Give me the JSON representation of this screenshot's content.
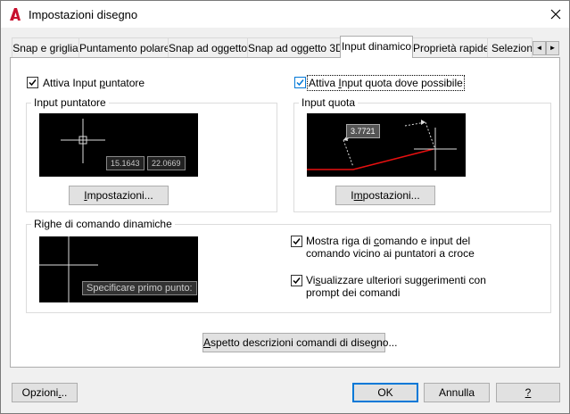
{
  "window": {
    "title": "Impostazioni disegno"
  },
  "tabs": [
    {
      "label": "Snap e griglia"
    },
    {
      "label": "Puntamento polare"
    },
    {
      "label": "Snap ad oggetto"
    },
    {
      "label": "Snap ad oggetto 3D"
    },
    {
      "label": "Input dinamico"
    },
    {
      "label": "Proprietà rapide"
    },
    {
      "label": "Selezione"
    }
  ],
  "tab_scroll": {
    "left": "◄",
    "right": "►"
  },
  "checkboxes": {
    "pointer_input": {
      "label_pre": "Attiva Input ",
      "label_u": "p",
      "label_post": "untatore",
      "checked": true
    },
    "dimension_input": {
      "label_pre": "Attiva ",
      "label_u": "I",
      "label_post": "nput quota dove possibile",
      "checked": true
    },
    "command_prompt": {
      "line1_pre": "Mostra riga di ",
      "line1_u": "c",
      "line1_post": "omando e input del",
      "line2": "comando vicino ai puntatori a croce",
      "checked": true
    },
    "extra_prompts": {
      "line1_pre": "Vi",
      "line1_u": "s",
      "line1_post": "ualizzare ulteriori suggerimenti con",
      "line2": "prompt dei comandi",
      "checked": true
    }
  },
  "groups": {
    "pointer_input": {
      "title": "Input puntatore",
      "preview_values": [
        "15.1643",
        "22.0669"
      ],
      "settings_button": {
        "pre": "",
        "u": "I",
        "post": "mpostazioni..."
      }
    },
    "dimension_input": {
      "title": "Input quota",
      "preview_value": "3.7721",
      "settings_button": {
        "pre": "I",
        "u": "m",
        "post": "postazioni..."
      }
    },
    "dynamic_prompts": {
      "title": "Righe di comando dinamiche",
      "preview_text": "Specificare primo punto:"
    }
  },
  "drafting_tooltip_button": {
    "pre": "",
    "u": "A",
    "post": "spetto descrizioni comandi di disegno..."
  },
  "footer": {
    "options": {
      "pre": "Opzioni",
      "u": ".",
      "post": ".."
    },
    "ok": "OK",
    "cancel": "Annulla",
    "help": "?"
  },
  "colors": {
    "accent": "#0078d7",
    "preview_bg": "#000000",
    "dimension_line": "#e81010",
    "app_icon": "#c8102e"
  }
}
